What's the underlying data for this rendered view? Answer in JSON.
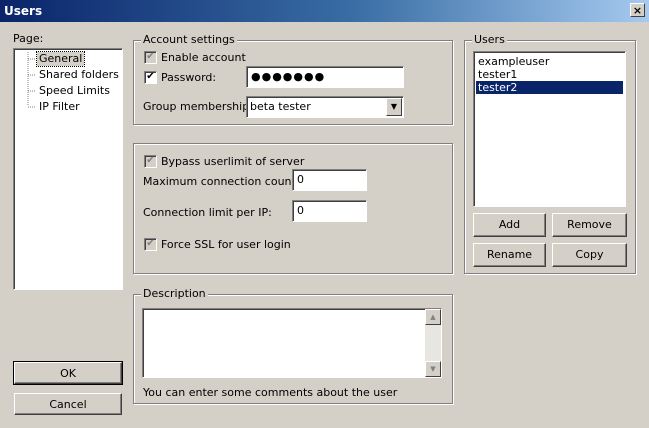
{
  "window": {
    "title": "Users",
    "close_glyph": "×"
  },
  "page_panel": {
    "label": "Page:",
    "items": [
      {
        "label": "General",
        "selected": true
      },
      {
        "label": "Shared folders",
        "selected": false
      },
      {
        "label": "Speed Limits",
        "selected": false
      },
      {
        "label": "IP Filter",
        "selected": false
      }
    ]
  },
  "account": {
    "legend": "Account settings",
    "enable_label": "Enable account",
    "enable_checked": true,
    "password_label": "Password:",
    "password_checked": true,
    "password_value": "●●●●●●●",
    "group_label": "Group membership:",
    "group_value": "beta tester"
  },
  "limits": {
    "bypass_label": "Bypass userlimit of server",
    "bypass_checked": true,
    "max_conn_label": "Maximum connection count:",
    "max_conn_value": "0",
    "per_ip_label": "Connection limit per IP:",
    "per_ip_value": "0",
    "ssl_label": "Force SSL for user login",
    "ssl_checked": true
  },
  "description": {
    "legend": "Description",
    "value": "",
    "hint": "You can enter some comments about the user"
  },
  "users": {
    "legend": "Users",
    "list": [
      {
        "name": "exampleuser",
        "selected": false
      },
      {
        "name": "tester1",
        "selected": false
      },
      {
        "name": "tester2",
        "selected": true
      }
    ],
    "add_label": "Add",
    "remove_label": "Remove",
    "rename_label": "Rename",
    "copy_label": "Copy"
  },
  "footer": {
    "ok_label": "OK",
    "cancel_label": "Cancel"
  },
  "icons": {
    "check": "✔",
    "dropdown": "chevron-down-icon",
    "scroll_up": "▲",
    "scroll_down": "▼"
  }
}
